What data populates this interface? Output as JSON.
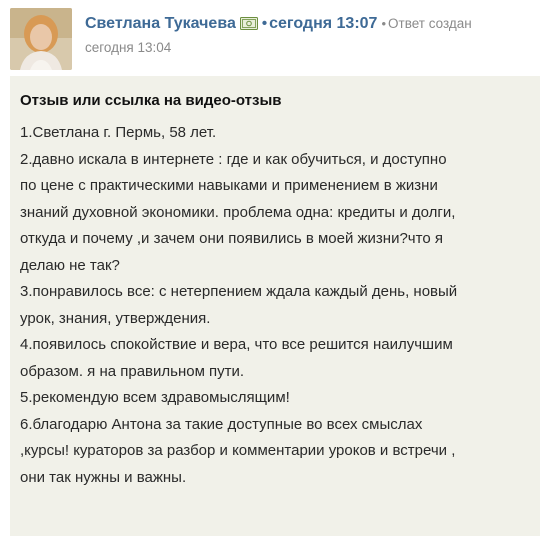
{
  "post": {
    "author_name": "Светлана Тукачева",
    "author_icon": "money-badge-icon",
    "separator": "•",
    "timestamp": "сегодня 13:07",
    "created_label": "Ответ создан",
    "created_time": "сегодня 13:04"
  },
  "answer": {
    "title": "Отзыв или ссылка на видео-отзыв",
    "lines": [
      "1.Светлана г. Пермь, 58 лет.",
      "2.давно искала в интернете : где и как обучиться, и доступно",
      "по цене с практическими навыками и применением в жизни",
      "знаний духовной экономики. проблема одна: кредиты и долги,",
      "откуда и почему ,и зачем они появились в моей жизни?что я",
      "делаю не так?",
      "3.понравилось все: с нетерпением ждала каждый день, новый",
      "урок, знания, утверждения.",
      "4.появилось спокойствие и вера, что все решится наилучшим",
      "образом. я на правильном пути.",
      "5.рекомендую всем здравомыслящим!",
      "6.благодарю Антона за такие доступные во всех смыслах",
      ",курсы! кураторов за разбор и комментарии уроков и встречи ,",
      " они так нужны и важны."
    ]
  },
  "colors": {
    "link": "#3e6a96",
    "muted": "#8a8a8a",
    "answer_background": "#f1f1e9"
  }
}
